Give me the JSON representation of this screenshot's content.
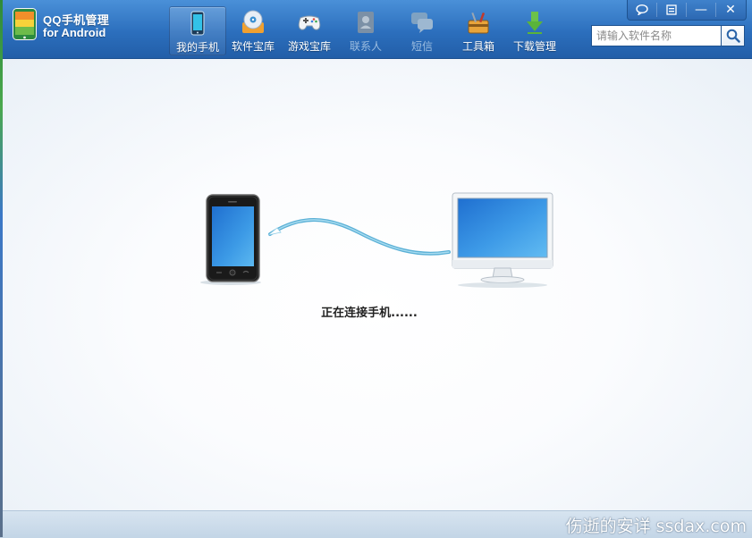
{
  "app": {
    "logo_line1": "QQ手机管理",
    "logo_line2": "for Android"
  },
  "nav": {
    "items": [
      {
        "label": "我的手机",
        "icon": "phone-icon",
        "active": true
      },
      {
        "label": "软件宝库",
        "icon": "software-disc-icon"
      },
      {
        "label": "游戏宝库",
        "icon": "gamepad-icon"
      },
      {
        "label": "联系人",
        "icon": "contacts-book-icon",
        "disabled": true
      },
      {
        "label": "短信",
        "icon": "sms-bubble-icon",
        "disabled": true
      },
      {
        "label": "工具箱",
        "icon": "toolbox-icon"
      },
      {
        "label": "下载管理",
        "icon": "download-arrow-icon"
      }
    ]
  },
  "window_controls": {
    "feedback_icon": "feedback-bubble-icon",
    "menu_icon": "menu-icon",
    "minimize": "—",
    "close": "✕"
  },
  "search": {
    "placeholder": "请输入软件名称",
    "icon": "search-icon"
  },
  "connection": {
    "status_text": "正在连接手机......"
  },
  "footer": {
    "watermark": "伤逝的安详 ssdax.com"
  },
  "colors": {
    "titlebar": "#2c6fbd",
    "cable": "#5ab0d6",
    "statusbar": "#c9d9e9"
  }
}
